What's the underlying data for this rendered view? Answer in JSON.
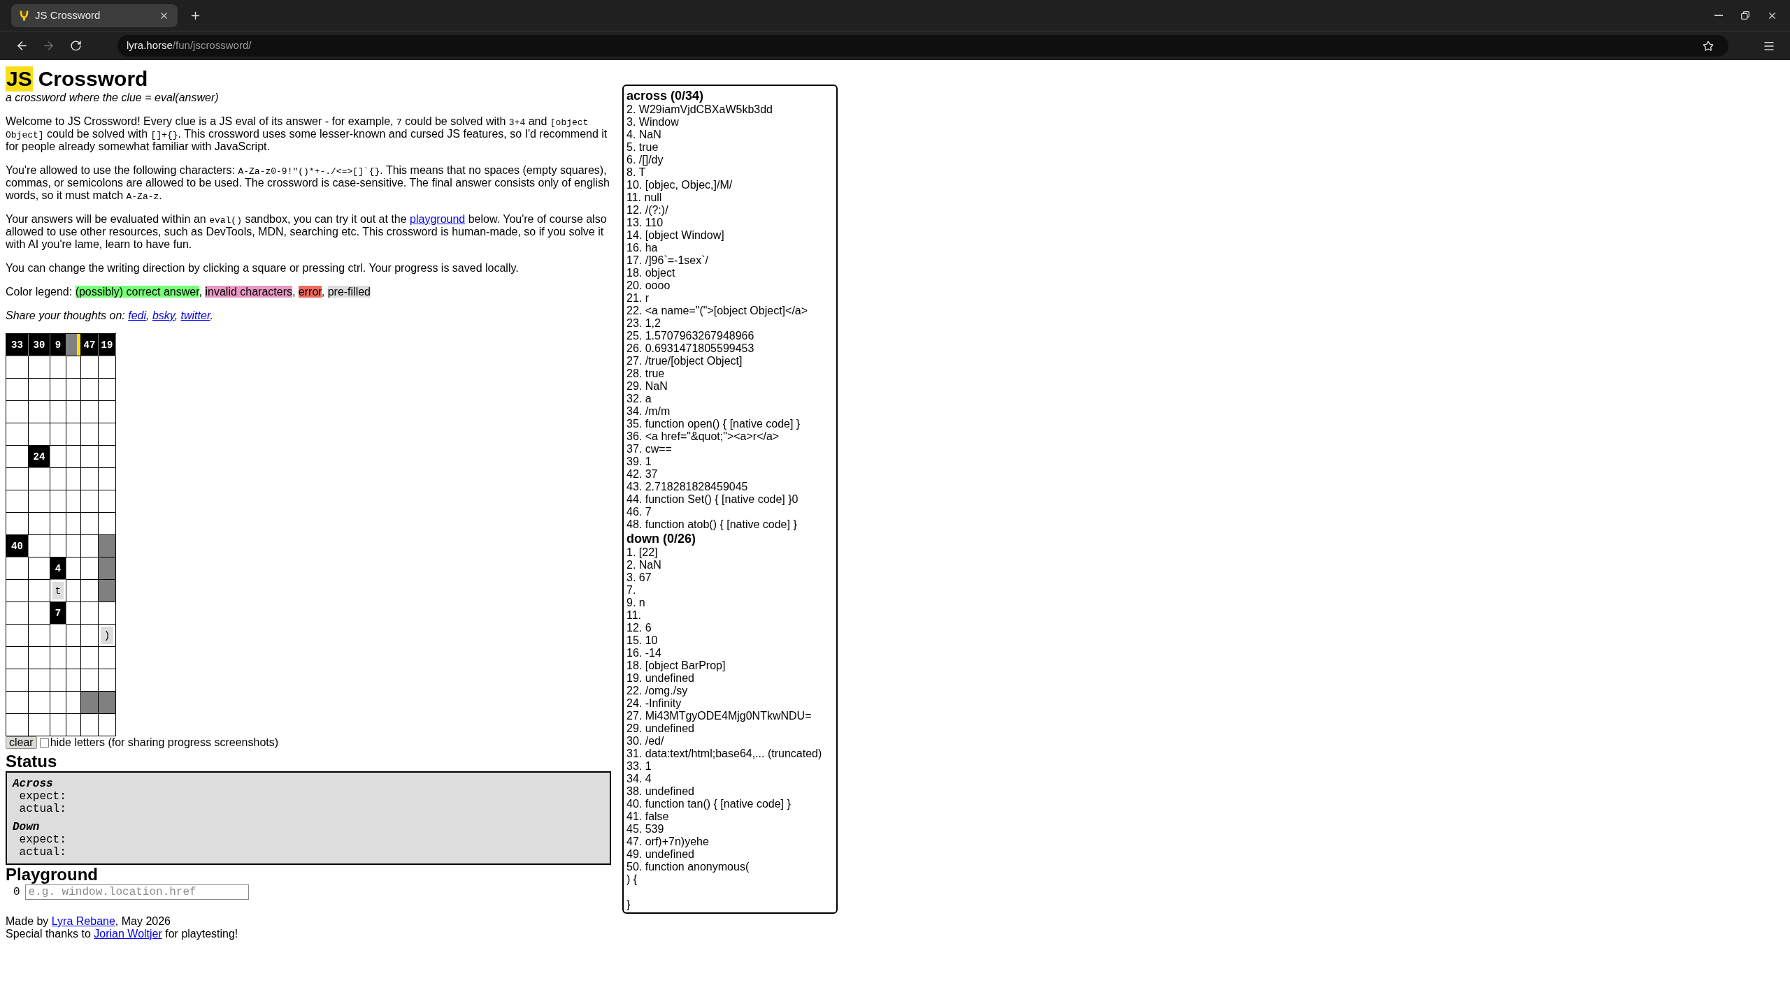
{
  "browser": {
    "tabs": [
      {
        "title": "JS Crossword",
        "selected": true
      }
    ],
    "back": {
      "disabled": false
    },
    "forward": {
      "disabled": true
    },
    "address": {
      "host": "lyra.horse",
      "path": "/fun/jscrossword/"
    }
  },
  "page": {
    "title": {
      "logo": "JS",
      "text": "Crossword"
    },
    "subtitle": "a crossword where the clue = eval(answer)",
    "paragraphs": [
      {
        "kind": "text",
        "segments": [
          {
            "kind": "text",
            "text": "Welcome to JS Crossword! Every clue is a JS eval of its answer - for example, "
          },
          {
            "kind": "code",
            "text": "7"
          },
          {
            "kind": "text",
            "text": " could be solved with "
          },
          {
            "kind": "code",
            "text": "3+4"
          },
          {
            "kind": "text",
            "text": " and "
          },
          {
            "kind": "code",
            "text": "[object Object]"
          },
          {
            "kind": "text",
            "text": " could be solved with "
          },
          {
            "kind": "code",
            "text": "[]+{}"
          },
          {
            "kind": "text",
            "text": ". This crossword uses some lesser-known and cursed JS features, so I'd recommend it for people already somewhat familiar with JavaScript."
          }
        ]
      },
      {
        "kind": "text",
        "segments": [
          {
            "kind": "text",
            "text": "You're allowed to use the following characters: "
          },
          {
            "kind": "code",
            "text": "A-Za-z0-9!\"()*+-./<=>[]`{}"
          },
          {
            "kind": "text",
            "text": ". This means that no spaces (empty squares), commas, or semicolons are allowed to be used. The crossword is case-sensitive. The final answer consists only of english words, so it must match "
          },
          {
            "kind": "code",
            "text": "A-Za-z"
          },
          {
            "kind": "text",
            "text": "."
          }
        ]
      },
      {
        "kind": "text",
        "segments": [
          {
            "kind": "text",
            "text": "Your answers will be evaluated within an "
          },
          {
            "kind": "code",
            "text": "eval()"
          },
          {
            "kind": "text",
            "text": " sandbox, you can try it out at the "
          },
          {
            "kind": "link",
            "text": "playground"
          },
          {
            "kind": "text",
            "text": " below. You're of course also allowed to use other resources, such as DevTools, MDN, searching etc. This crossword is human-made, so if you solve it with AI you're lame, learn to have fun."
          }
        ]
      },
      {
        "kind": "text",
        "segments": [
          {
            "kind": "text",
            "text": "You can change the writing direction by clicking a square or pressing ctrl. Your progress is saved locally."
          }
        ]
      },
      {
        "kind": "legend",
        "segments": [
          {
            "kind": "text",
            "text": "Color legend: "
          },
          {
            "kind": "swatch",
            "text": "(possibly) correct answer",
            "color": "#77ff77"
          },
          {
            "kind": "text",
            "text": ", "
          },
          {
            "kind": "swatch",
            "text": "invalid characters",
            "color": "#e99ac4"
          },
          {
            "kind": "text",
            "text": ", "
          },
          {
            "kind": "swatch",
            "text": "error",
            "color": "#ef6b5f"
          },
          {
            "kind": "text",
            "text": ", "
          },
          {
            "kind": "swatch",
            "text": "pre-filled",
            "color": "#dddddd"
          }
        ]
      },
      {
        "kind": "share",
        "segments": [
          {
            "kind": "text",
            "text": "Share your thoughts on: "
          },
          {
            "kind": "link",
            "text": "fedi"
          },
          {
            "kind": "text",
            "text": ", "
          },
          {
            "kind": "link",
            "text": "bsky"
          },
          {
            "kind": "text",
            "text": ", "
          },
          {
            "kind": "link",
            "text": "twitter"
          },
          {
            "kind": "text",
            "text": "."
          }
        ]
      }
    ],
    "crossword": {
      "rows": [
        {
          "cells": [
            {
              "kind": "block",
              "label": "33"
            },
            {
              "kind": "block",
              "label": "30"
            },
            {
              "kind": "block",
              "label": "9"
            },
            {
              "kind": "active"
            },
            {
              "kind": "block",
              "label": "47"
            },
            {
              "kind": "block",
              "label": "19"
            }
          ]
        },
        {
          "cells": [
            {
              "kind": "blank"
            },
            {
              "kind": "blank"
            },
            {
              "kind": "blank"
            },
            {
              "kind": "blank"
            },
            {
              "kind": "blank"
            },
            {
              "kind": "blank"
            }
          ]
        },
        {
          "cells": [
            {
              "kind": "blank"
            },
            {
              "kind": "blank"
            },
            {
              "kind": "blank"
            },
            {
              "kind": "blank"
            },
            {
              "kind": "blank"
            },
            {
              "kind": "blank"
            }
          ]
        },
        {
          "cells": [
            {
              "kind": "blank"
            },
            {
              "kind": "blank"
            },
            {
              "kind": "blank"
            },
            {
              "kind": "blank"
            },
            {
              "kind": "blank"
            },
            {
              "kind": "blank"
            }
          ]
        },
        {
          "cells": [
            {
              "kind": "blank"
            },
            {
              "kind": "blank"
            },
            {
              "kind": "blank"
            },
            {
              "kind": "blank"
            },
            {
              "kind": "blank"
            },
            {
              "kind": "blank"
            }
          ]
        },
        {
          "cells": [
            {
              "kind": "blank"
            },
            {
              "kind": "block",
              "label": "24"
            },
            {
              "kind": "blank"
            },
            {
              "kind": "blank"
            },
            {
              "kind": "blank"
            },
            {
              "kind": "blank"
            }
          ]
        },
        {
          "cells": [
            {
              "kind": "blank"
            },
            {
              "kind": "blank"
            },
            {
              "kind": "blank"
            },
            {
              "kind": "blank"
            },
            {
              "kind": "blank"
            },
            {
              "kind": "blank"
            }
          ]
        },
        {
          "cells": [
            {
              "kind": "blank"
            },
            {
              "kind": "blank"
            },
            {
              "kind": "blank"
            },
            {
              "kind": "blank"
            },
            {
              "kind": "blank"
            },
            {
              "kind": "blank"
            }
          ]
        },
        {
          "cells": [
            {
              "kind": "blank"
            },
            {
              "kind": "blank"
            },
            {
              "kind": "blank"
            },
            {
              "kind": "blank"
            },
            {
              "kind": "blank"
            },
            {
              "kind": "blank"
            }
          ]
        },
        {
          "cells": [
            {
              "kind": "block",
              "label": "40"
            },
            {
              "kind": "blank"
            },
            {
              "kind": "blank"
            },
            {
              "kind": "blank"
            },
            {
              "kind": "blank"
            },
            {
              "kind": "shaded"
            }
          ]
        },
        {
          "cells": [
            {
              "kind": "blank"
            },
            {
              "kind": "blank"
            },
            {
              "kind": "block",
              "label": "4"
            },
            {
              "kind": "blank"
            },
            {
              "kind": "blank"
            },
            {
              "kind": "shaded"
            }
          ]
        },
        {
          "cells": [
            {
              "kind": "blank"
            },
            {
              "kind": "blank"
            },
            {
              "kind": "prefilled",
              "label": "t"
            },
            {
              "kind": "blank"
            },
            {
              "kind": "blank"
            },
            {
              "kind": "shaded"
            }
          ]
        },
        {
          "cells": [
            {
              "kind": "blank"
            },
            {
              "kind": "blank"
            },
            {
              "kind": "block",
              "label": "7"
            },
            {
              "kind": "blank"
            },
            {
              "kind": "blank"
            },
            {
              "kind": "blank"
            }
          ]
        },
        {
          "cells": [
            {
              "kind": "blank"
            },
            {
              "kind": "blank"
            },
            {
              "kind": "blank"
            },
            {
              "kind": "blank"
            },
            {
              "kind": "blank"
            },
            {
              "kind": "prefilled",
              "label": ")"
            }
          ]
        },
        {
          "cells": [
            {
              "kind": "blank"
            },
            {
              "kind": "blank"
            },
            {
              "kind": "blank"
            },
            {
              "kind": "blank"
            },
            {
              "kind": "blank"
            },
            {
              "kind": "blank"
            }
          ]
        },
        {
          "cells": [
            {
              "kind": "blank"
            },
            {
              "kind": "blank"
            },
            {
              "kind": "blank"
            },
            {
              "kind": "blank"
            },
            {
              "kind": "blank"
            },
            {
              "kind": "blank"
            }
          ]
        },
        {
          "cells": [
            {
              "kind": "blank"
            },
            {
              "kind": "blank"
            },
            {
              "kind": "blank"
            },
            {
              "kind": "blank"
            },
            {
              "kind": "shaded"
            },
            {
              "kind": "shaded"
            }
          ]
        },
        {
          "cells": [
            {
              "kind": "blank"
            },
            {
              "kind": "blank"
            },
            {
              "kind": "blank"
            },
            {
              "kind": "blank"
            },
            {
              "kind": "blank"
            },
            {
              "kind": "blank"
            }
          ]
        }
      ]
    },
    "controls": {
      "clear_button": "clear",
      "hide_letters": {
        "label": "hide letters (for sharing progress screenshots)",
        "checked": false
      }
    },
    "status": {
      "heading": "Status",
      "sections": [
        {
          "title": "Across",
          "lines": [
            "expect:",
            "actual:"
          ]
        },
        {
          "title": "Down",
          "lines": [
            "expect:",
            "actual:"
          ]
        }
      ]
    },
    "playground": {
      "heading": "Playground",
      "line_number": "0",
      "placeholder": "e.g. window.location.href"
    },
    "footer": [
      {
        "segments": [
          {
            "kind": "text",
            "text": "Made by "
          },
          {
            "kind": "link",
            "text": "Lyra Rebane"
          },
          {
            "kind": "text",
            "text": ", May 2026"
          }
        ]
      },
      {
        "segments": [
          {
            "kind": "text",
            "text": "Special thanks to "
          },
          {
            "kind": "link",
            "text": "Jorian Woltjer"
          },
          {
            "kind": "text",
            "text": " for playtesting!"
          }
        ]
      }
    ]
  },
  "clues": [
    {
      "heading": "across (0/34)",
      "items": [
        "2. W29iamVjdCBXaW5kb3dd",
        "3. Window",
        "4. NaN",
        "5. true",
        "6. /[]/dy",
        "8. T",
        "10. [objec, Objec,]/M/",
        "11. null",
        "12. /(?:)/",
        "13. 110",
        "14. [object Window]",
        "16. ha",
        "17. /]96`=-1sex`/",
        "18. object",
        "20. oooo",
        "21. r",
        "22. <a name=\"(\">[object Object]</a>",
        "23. 1,2",
        "25. 1.5707963267948966",
        "26. 0.6931471805599453",
        "27. /true/[object Object]",
        "28. true",
        "29. NaN",
        "32. a",
        "34. /m/m",
        "35. function open() { [native code] }",
        "36. <a href=\"&quot;\"><a>r</a>",
        "37. cw==",
        "39. 1",
        "42. 37",
        "43. 2.718281828459045",
        "44. function Set() { [native code] }0",
        "46. 7",
        "48. function atob() { [native code] }"
      ]
    },
    {
      "heading": "down (0/26)",
      "items": [
        "1. [22]",
        "2. NaN",
        "3. 67",
        "7.",
        "9. n",
        "11.",
        "12. 6",
        "15. 10",
        "16. -14",
        "18. [object BarProp]",
        "19. undefined",
        "22. /omg./sy",
        "24. -Infinity",
        "27. Mi43MTgyODE4Mjg0NTkwNDU=",
        "29. undefined",
        "30. /ed/",
        "31. data:text/html;base64,... (truncated)",
        "33. 1",
        "34. 4",
        "38. undefined",
        "40. function tan() { [native code] }",
        "41. false",
        "45. 539",
        "47. orf)+7n)yehe",
        "49. undefined",
        "50. function anonymous(\n) {\n\n}"
      ]
    }
  ]
}
